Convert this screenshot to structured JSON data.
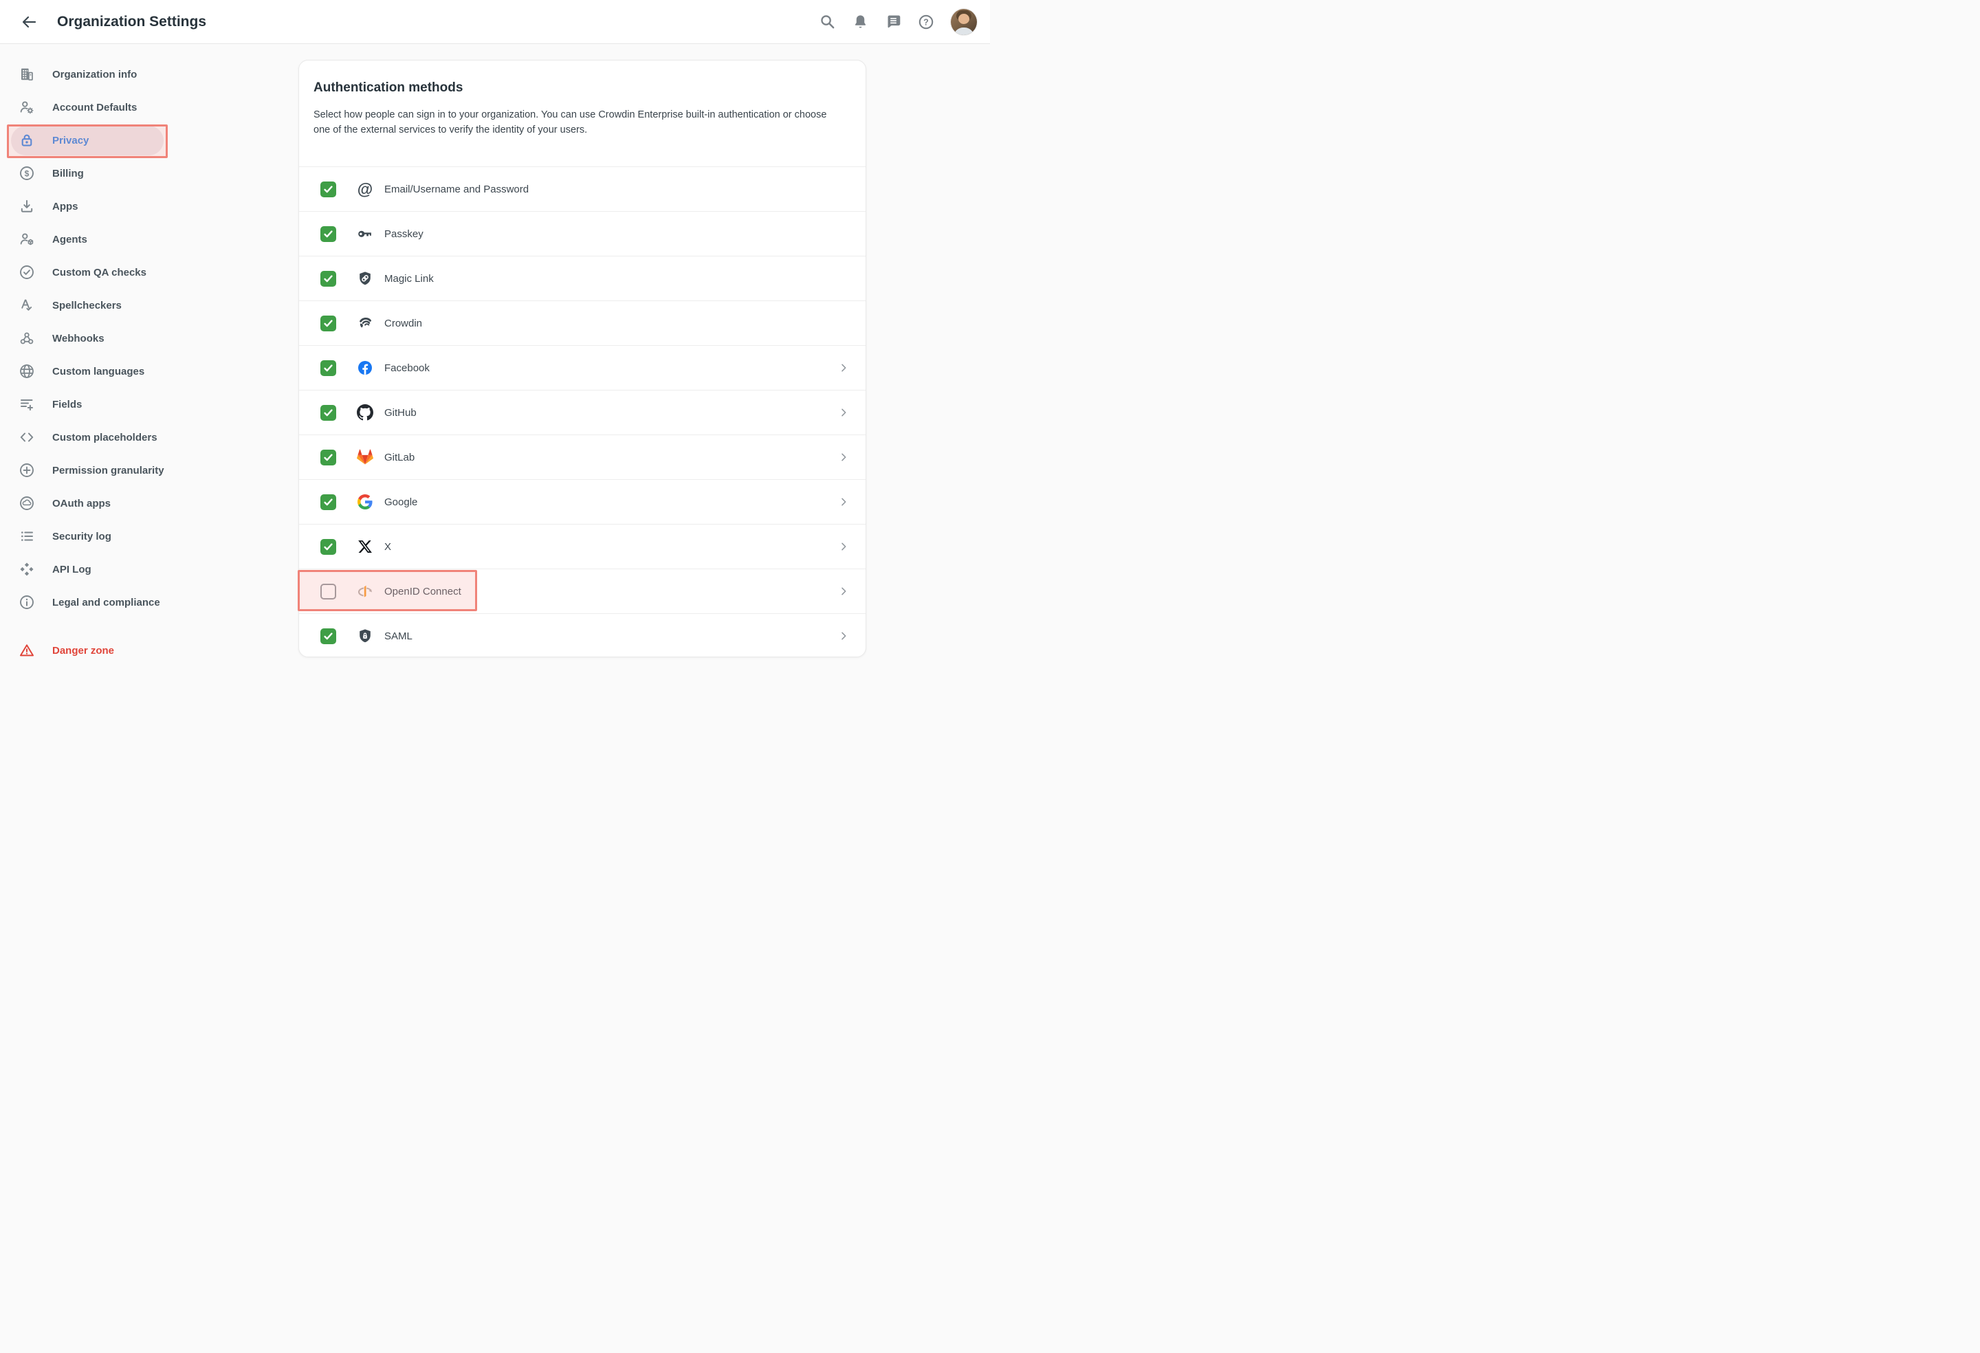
{
  "header": {
    "title": "Organization Settings",
    "icons": [
      "back-arrow",
      "search",
      "notifications-bell",
      "messages",
      "help",
      "avatar"
    ]
  },
  "sidebar": {
    "items": [
      {
        "label": "Organization info",
        "icon": "building-icon"
      },
      {
        "label": "Account Defaults",
        "icon": "user-gear-icon"
      },
      {
        "label": "Privacy",
        "icon": "lock-icon",
        "active": true,
        "highlighted": true
      },
      {
        "label": "Billing",
        "icon": "dollar-circle-icon"
      },
      {
        "label": "Apps",
        "icon": "download-icon"
      },
      {
        "label": "Agents",
        "icon": "user-cube-icon"
      },
      {
        "label": "Custom QA checks",
        "icon": "check-circle-icon"
      },
      {
        "label": "Spellcheckers",
        "icon": "spellcheck-icon"
      },
      {
        "label": "Webhooks",
        "icon": "webhook-icon"
      },
      {
        "label": "Custom languages",
        "icon": "globe-icon"
      },
      {
        "label": "Fields",
        "icon": "list-plus-icon"
      },
      {
        "label": "Custom placeholders",
        "icon": "angle-brackets-icon"
      },
      {
        "label": "Permission granularity",
        "icon": "plus-circle-icon"
      },
      {
        "label": "OAuth apps",
        "icon": "cloud-circle-icon"
      },
      {
        "label": "Security log",
        "icon": "bulleted-list-icon"
      },
      {
        "label": "API Log",
        "icon": "diamonds-icon"
      },
      {
        "label": "Legal and compliance",
        "icon": "info-circle-icon"
      },
      {
        "label": "Danger zone",
        "icon": "warning-triangle-icon",
        "danger": true
      }
    ]
  },
  "main": {
    "card": {
      "title": "Authentication methods",
      "description": "Select how people can sign in to your organization. You can use Crowdin Enterprise built-in authentication or choose one of the external services to verify the identity of your users.",
      "rows": [
        {
          "label": "Email/Username and Password",
          "icon": "at-icon",
          "checked": true,
          "chevron": false
        },
        {
          "label": "Passkey",
          "icon": "key-icon",
          "checked": true,
          "chevron": false
        },
        {
          "label": "Magic Link",
          "icon": "shield-link-icon",
          "checked": true,
          "chevron": false
        },
        {
          "label": "Crowdin",
          "icon": "crowdin-icon",
          "checked": true,
          "chevron": false
        },
        {
          "label": "Facebook",
          "icon": "facebook-icon",
          "checked": true,
          "chevron": true
        },
        {
          "label": "GitHub",
          "icon": "github-icon",
          "checked": true,
          "chevron": true
        },
        {
          "label": "GitLab",
          "icon": "gitlab-icon",
          "checked": true,
          "chevron": true
        },
        {
          "label": "Google",
          "icon": "google-icon",
          "checked": true,
          "chevron": true
        },
        {
          "label": "X",
          "icon": "x-icon",
          "checked": true,
          "chevron": true
        },
        {
          "label": "OpenID Connect",
          "icon": "openid-icon",
          "checked": false,
          "chevron": true,
          "highlighted": true
        },
        {
          "label": "SAML",
          "icon": "saml-shield-icon",
          "checked": true,
          "chevron": true
        }
      ]
    }
  },
  "colors": {
    "checkbox_green": "#3f9e46",
    "active_blue": "#2b7ce0",
    "danger_red": "#e0453a",
    "annotation_red": "#f08379",
    "facebook_blue": "#1877f2",
    "card_background": "#ffffff",
    "page_background": "#fafafa"
  }
}
